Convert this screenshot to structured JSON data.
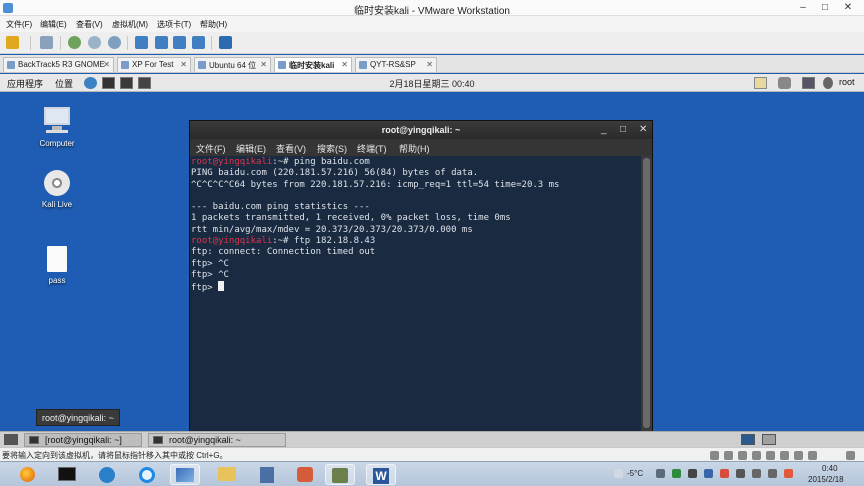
{
  "vmware": {
    "title": "临时安装kali - VMware Workstation",
    "controls": [
      "–",
      "□",
      "✕"
    ],
    "menu": [
      "文件(F)",
      "编辑(E)",
      "查看(V)",
      "虚拟机(M)",
      "选项卡(T)",
      "帮助(H)"
    ],
    "tabs": [
      {
        "label": "BackTrack5 R3 GNOME",
        "active": false
      },
      {
        "label": "XP For Test",
        "active": false
      },
      {
        "label": "Ubuntu 64 位",
        "active": false
      },
      {
        "label": "临时安装kali",
        "active": true
      },
      {
        "label": "QYT-RS&SP",
        "active": false
      }
    ],
    "status_message": "要将输入定向到该虚拟机，请将鼠标指针移入其中或按 Ctrl+G。"
  },
  "gnome_top": {
    "applications": "应用程序",
    "places": "位置",
    "clock": "2月18日星期三 00:40",
    "user": "root"
  },
  "desktop": {
    "icons": [
      {
        "label": "Computer",
        "icon": "computer-icon"
      },
      {
        "label": "Kali Live",
        "icon": "disc-icon"
      },
      {
        "label": "pass",
        "icon": "file-icon"
      }
    ],
    "tooltip": "root@yingqikali: ~"
  },
  "terminal": {
    "title": "root@yingqikali: ~",
    "controls": [
      "_",
      "□",
      "✕"
    ],
    "menu": [
      "文件(F)",
      "编辑(E)",
      "查看(V)",
      "搜索(S)",
      "终端(T)",
      "帮助(H)"
    ],
    "prompt_user": "root@yingqikali",
    "prompt_suffix": ":~# ",
    "commands": [
      "ping baidu.com",
      "ftp 182.18.8.43"
    ],
    "ping_output": [
      "PING baidu.com (220.181.57.216) 56(84) bytes of data.",
      "^C^C^C^C64 bytes from 220.181.57.216: icmp_req=1 ttl=54 time=20.3 ms",
      "",
      "--- baidu.com ping statistics ---",
      "1 packets transmitted, 1 received, 0% packet loss, time 0ms",
      "rtt min/avg/max/mdev = 20.373/20.373/20.373/0.000 ms"
    ],
    "ftp_output": [
      "ftp: connect: Connection timed out",
      "ftp> ^C",
      "ftp> ^C"
    ],
    "last_prompt": "ftp> "
  },
  "gnome_bottom": {
    "tasks": [
      "[root@yingqikali: ~]",
      "root@yingqikali: ~"
    ]
  },
  "windows_taskbar": {
    "weather": "-5°C",
    "time": "0:40",
    "date": "2015/2/18",
    "app_icons": [
      "firefox-icon",
      "terminal-icon",
      "network-icon",
      "ie-icon",
      "vmware-icon",
      "explorer-icon",
      "tool-icon",
      "paint-icon",
      "wireshark-icon",
      "word-icon"
    ]
  },
  "colors": {
    "desktop": "#1e5db3",
    "terminal_bg": "#1a2a40",
    "prompt": "#e0344a"
  }
}
